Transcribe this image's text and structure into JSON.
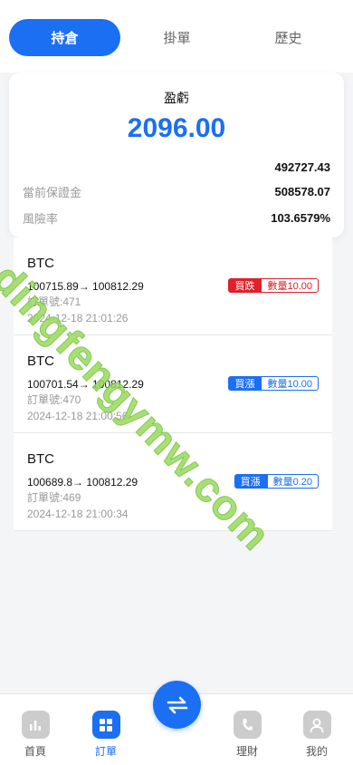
{
  "tabs": [
    {
      "label": "持倉",
      "active": true
    },
    {
      "label": "掛單",
      "active": false
    },
    {
      "label": "歷史",
      "active": false
    }
  ],
  "summary": {
    "pl_label": "盈虧",
    "pl_value": "2096.00",
    "rows": [
      {
        "label": "",
        "value": "492727.43"
      },
      {
        "label": "當前保證金",
        "value": "508578.07"
      },
      {
        "label": "風險率",
        "value": "103.6579%"
      }
    ]
  },
  "orders": [
    {
      "symbol": "BTC",
      "prices": "100715.89→ 100812.29",
      "order_no": "訂單號:471",
      "time": "2024-12-18 21:01:26",
      "direction": "買跌",
      "qty": "數量10.00",
      "type": "sell"
    },
    {
      "symbol": "BTC",
      "prices": "100701.54→ 100812.29",
      "order_no": "訂單號:470",
      "time": "2024-12-18 21:00:56",
      "direction": "買漲",
      "qty": "數量10.00",
      "type": "buy"
    },
    {
      "symbol": "BTC",
      "prices": "100689.8→ 100812.29",
      "order_no": "訂單號:469",
      "time": "2024-12-18 21:00:34",
      "direction": "買漲",
      "qty": "數量0.20",
      "type": "buy"
    }
  ],
  "watermark": "dingfengymw.com",
  "nav": [
    {
      "label": "首頁",
      "icon": "chart-icon"
    },
    {
      "label": "訂單",
      "icon": "grid-icon",
      "active": true
    },
    {
      "label": "理財",
      "icon": "phone-icon"
    },
    {
      "label": "我的",
      "icon": "user-icon"
    }
  ],
  "center_button": {
    "icon": "swap-icon"
  },
  "colors": {
    "accent": "#1b6ff3",
    "sell": "#e0202b",
    "watermark": "#9bd95e"
  }
}
